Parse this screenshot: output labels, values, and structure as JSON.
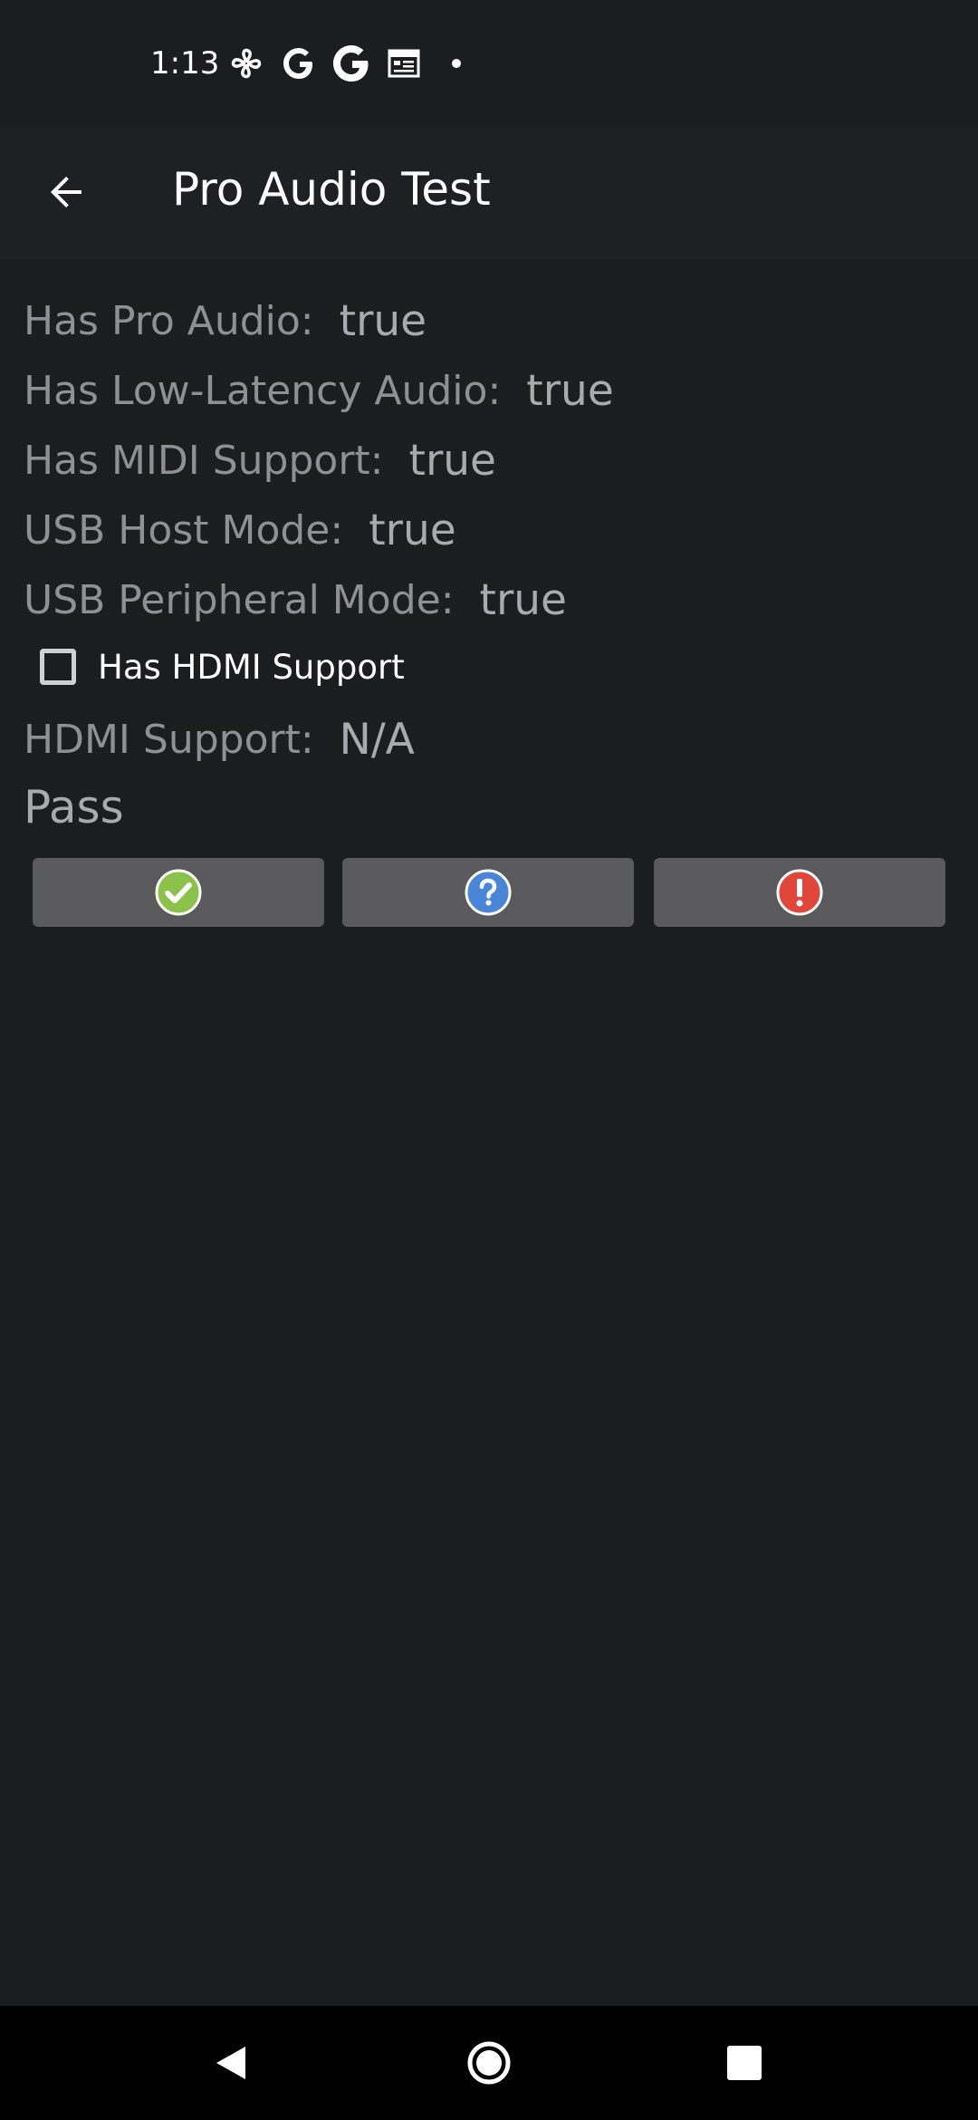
{
  "status_bar": {
    "time": "1:13",
    "icons": [
      "fan-icon",
      "google-g-icon",
      "google-g-bold-icon",
      "calendar-icon",
      "dot-icon"
    ]
  },
  "app_bar": {
    "title": "Pro Audio Test",
    "back_icon": "arrow-back-icon"
  },
  "info": [
    {
      "label": "Has Pro Audio:",
      "value": "true"
    },
    {
      "label": "Has Low-Latency Audio:",
      "value": "true"
    },
    {
      "label": "Has MIDI Support:",
      "value": "true"
    },
    {
      "label": "USB Host Mode:",
      "value": "true"
    },
    {
      "label": "USB Peripheral Mode:",
      "value": "true"
    }
  ],
  "hdmi_checkbox": {
    "label": "Has HDMI Support",
    "checked": false
  },
  "hdmi_support": {
    "label": "HDMI Support:",
    "value": "N/A"
  },
  "result_text": "Pass",
  "result_buttons": [
    {
      "name": "pass",
      "icon": "check-circle-icon",
      "color": "#8bc34a"
    },
    {
      "name": "info",
      "icon": "question-circle-icon",
      "color": "#4a86d8"
    },
    {
      "name": "fail",
      "icon": "exclamation-circle-icon",
      "color": "#e0463a"
    }
  ],
  "nav_bar": {
    "icons": [
      "nav-back-icon",
      "nav-home-icon",
      "nav-recents-icon"
    ]
  },
  "colors": {
    "background": "#1c1d1f",
    "app_bar": "#1f2022",
    "button": "#5a5a5c",
    "nav_bar": "#000000"
  }
}
